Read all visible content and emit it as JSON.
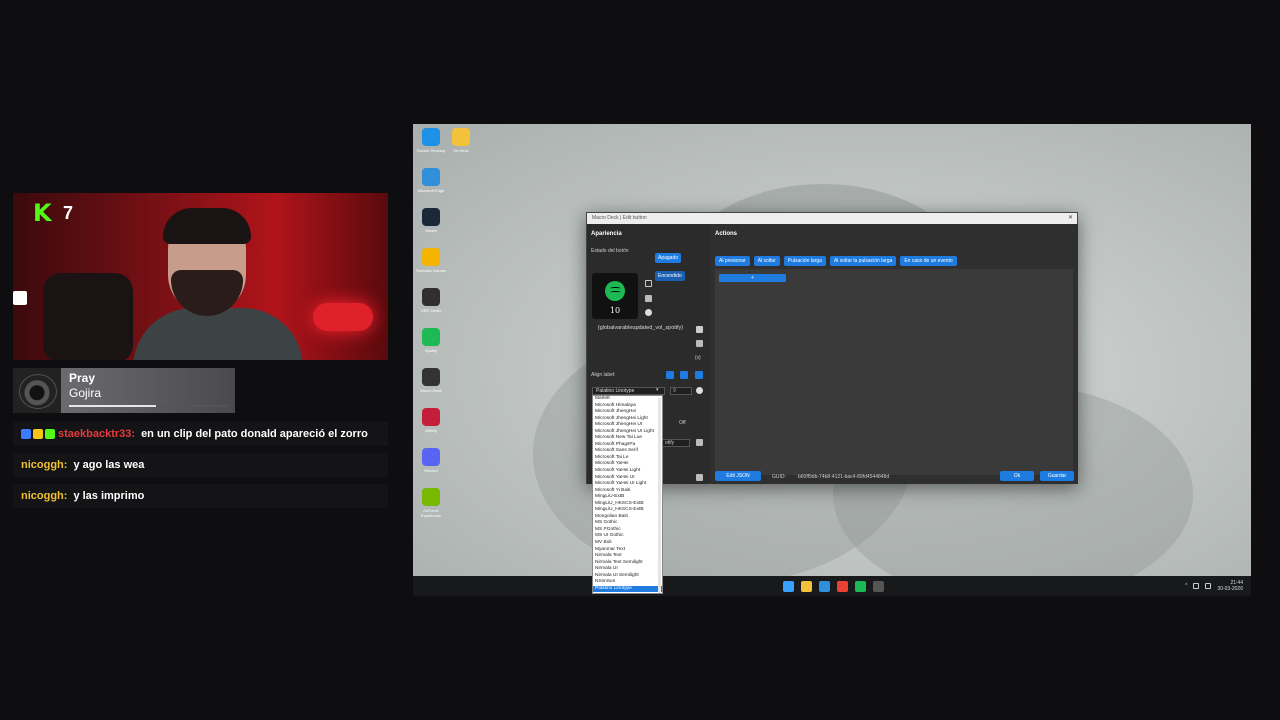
{
  "stream": {
    "kick_count": "7",
    "now_playing": {
      "title": "Pray",
      "artist": "Gojira",
      "progress": 0.55
    },
    "chat": [
      {
        "user": "staekbacktr33:",
        "user_color": "#e23b3b",
        "text": "en un clip del pato donald apareció el zorro",
        "badges": [
          "#3b7bff",
          "#f5c518",
          "#53fc18"
        ]
      },
      {
        "user": "nicoggh:",
        "user_color": "#f0c030",
        "text": "y ago las wea",
        "badges": []
      },
      {
        "user": "nicoggh:",
        "user_color": "#f0c030",
        "text": "y las imprimo",
        "badges": []
      }
    ]
  },
  "desktop": {
    "icons": [
      {
        "label": "Docker Desktop",
        "icon": "docker-icon",
        "color": "#1d91e6"
      },
      {
        "label": "Sin título",
        "icon": "folder-icon",
        "color": "#f3c13a"
      },
      {
        "label": "Microsoft Edge",
        "icon": "edge-icon",
        "color": "#2f8fd8"
      },
      {
        "label": "",
        "icon": "blank",
        "color": "transparent"
      },
      {
        "label": "Steam",
        "icon": "steam-icon",
        "color": "#1b2838"
      },
      {
        "label": "",
        "icon": "blank",
        "color": "transparent"
      },
      {
        "label": "Rockstar Games",
        "icon": "rockstar-icon",
        "color": "#f4b400"
      },
      {
        "label": "",
        "icon": "blank",
        "color": "transparent"
      },
      {
        "label": "OBS Studio",
        "icon": "obs-icon",
        "color": "#302e31"
      },
      {
        "label": "",
        "icon": "blank",
        "color": "transparent"
      },
      {
        "label": "Spotify",
        "icon": "spotify-icon",
        "color": "#1db954"
      },
      {
        "label": "",
        "icon": "blank",
        "color": "transparent"
      },
      {
        "label": "Macro Deck",
        "icon": "macrodeck-icon",
        "color": "#333"
      },
      {
        "label": "",
        "icon": "blank",
        "color": "transparent"
      },
      {
        "label": "Affinity",
        "icon": "affinity-icon",
        "color": "#c41e3a"
      },
      {
        "label": "",
        "icon": "blank",
        "color": "transparent"
      },
      {
        "label": "Discord",
        "icon": "discord-icon",
        "color": "#5865f2"
      },
      {
        "label": "",
        "icon": "blank",
        "color": "transparent"
      },
      {
        "label": "GeForce Experience",
        "icon": "nvidia-icon",
        "color": "#76b900"
      }
    ],
    "taskbar": {
      "apps": [
        {
          "icon": "windows-start-icon",
          "color": "#3aa0ff"
        },
        {
          "icon": "file-explorer-icon",
          "color": "#f3c13a"
        },
        {
          "icon": "edge-icon",
          "color": "#2f8fd8"
        },
        {
          "icon": "chrome-icon",
          "color": "#e94235"
        },
        {
          "icon": "spotify-icon",
          "color": "#1db954"
        },
        {
          "icon": "macrodeck-icon",
          "color": "#555"
        }
      ],
      "time": "21:44",
      "date": "30-03-2026"
    }
  },
  "window": {
    "title": "Macro Deck | Edit button",
    "appearance": {
      "heading": "Apariencia",
      "state_label": "Estado del botón",
      "state_off": "Apagado",
      "state_on": "Encendido",
      "preview_number": "10",
      "variable_text": "{globalvarableupdated_vol_spotify}",
      "variable_icon": "{x}",
      "align_label": "Align label:",
      "font_selected": "Palatino Linotype",
      "font_size": "9",
      "off_label": "Off",
      "small_select": "otify",
      "fonts": [
        "Marlett",
        "Microsoft Himalaya",
        "Microsoft JhengHei",
        "Microsoft JhengHei Light",
        "Microsoft JhengHei UI",
        "Microsoft JhengHei UI Light",
        "Microsoft New Tai Lue",
        "Microsoft PhagsPa",
        "Microsoft Sans Serif",
        "Microsoft Tai Le",
        "Microsoft YaHei",
        "Microsoft YaHei Light",
        "Microsoft YaHei UI",
        "Microsoft YaHei UI Light",
        "Microsoft Yi Baiti",
        "MingLiU-ExtB",
        "MingLiU_HKSCS-ExtB",
        "MingLiU_HKSCS-ExtB",
        "Mongolian Baiti",
        "MS Gothic",
        "MS PGothic",
        "MS UI Gothic",
        "MV Boli",
        "Myanmar Text",
        "Nirmala Text",
        "Nirmala Text Semilight",
        "Nirmala UI",
        "Nirmala UI Semilight",
        "NSimSun",
        "Palatino Linotype"
      ]
    },
    "actions": {
      "heading": "Actions",
      "tabs": [
        "Al presionar",
        "Al soltar",
        "Pulsación larga",
        "Al soltar la pulsación larga",
        "En caso de un evento"
      ],
      "add_label": "+"
    },
    "footer": {
      "edit_json": "Edit JSON",
      "guid_label": "GUID:",
      "guid_value": "b60ff9db-74b8-4121-bac4-89fd4544848d",
      "ok": "Ok",
      "save": "Guardar"
    }
  }
}
